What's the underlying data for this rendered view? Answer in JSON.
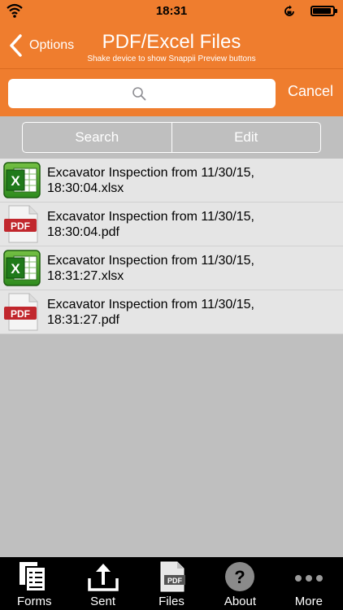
{
  "status": {
    "time": "18:31"
  },
  "nav": {
    "back_label": "Options",
    "title": "PDF/Excel Files",
    "subtitle": "Shake device to show Snappii Preview buttons"
  },
  "search": {
    "placeholder": "",
    "cancel": "Cancel"
  },
  "segments": {
    "search": "Search",
    "edit": "Edit"
  },
  "files": [
    {
      "line1": "Excavator Inspection from 11/30/15,",
      "line2": "18:30:04.xlsx",
      "type": "xlsx"
    },
    {
      "line1": "Excavator Inspection from 11/30/15,",
      "line2": "18:30:04.pdf",
      "type": "pdf"
    },
    {
      "line1": "Excavator Inspection from 11/30/15,",
      "line2": "18:31:27.xlsx",
      "type": "xlsx"
    },
    {
      "line1": "Excavator Inspection from 11/30/15,",
      "line2": "18:31:27.pdf",
      "type": "pdf"
    }
  ],
  "tabs": {
    "forms": "Forms",
    "sent": "Sent",
    "files": "Files",
    "about": "About",
    "more": "More"
  },
  "icons": {
    "pdf_badge": "PDF",
    "excel_badge": "X",
    "files_badge": "PDF",
    "about_badge": "?"
  },
  "colors": {
    "accent": "#ef7d2e",
    "background": "#bfbfbf",
    "row": "#e5e5e5",
    "tabbar": "#000000"
  }
}
